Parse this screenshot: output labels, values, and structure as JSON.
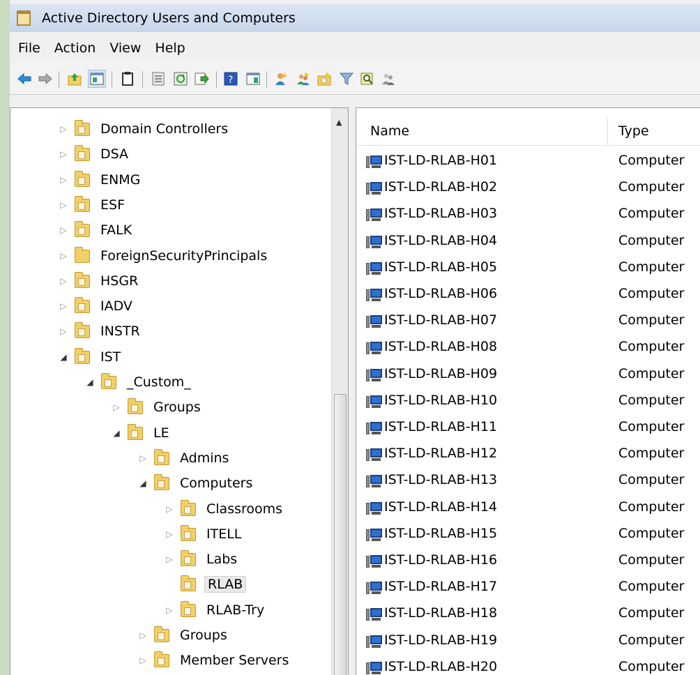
{
  "window": {
    "title": "Active Directory Users and Computers"
  },
  "menu": [
    "File",
    "Action",
    "View",
    "Help"
  ],
  "toolbar_icons": [
    "back-arrow-icon",
    "forward-arrow-icon",
    "up-folder-icon",
    "show-hide-console-tree-icon",
    "clipboard-icon",
    "properties-icon",
    "refresh-icon",
    "export-list-icon",
    "help-icon",
    "show-action-pane-icon",
    "new-user-icon",
    "new-group-icon",
    "new-ou-icon",
    "filter-icon",
    "find-icon",
    "add-to-group-icon"
  ],
  "tree": [
    {
      "label": "Domain Controllers",
      "level": 0,
      "state": "collapsed"
    },
    {
      "label": "DSA",
      "level": 0,
      "state": "collapsed"
    },
    {
      "label": "ENMG",
      "level": 0,
      "state": "collapsed"
    },
    {
      "label": "ESF",
      "level": 0,
      "state": "collapsed"
    },
    {
      "label": "FALK",
      "level": 0,
      "state": "collapsed"
    },
    {
      "label": "ForeignSecurityPrincipals",
      "level": 0,
      "state": "collapsed",
      "plain": true
    },
    {
      "label": "HSGR",
      "level": 0,
      "state": "collapsed"
    },
    {
      "label": "IADV",
      "level": 0,
      "state": "collapsed"
    },
    {
      "label": "INSTR",
      "level": 0,
      "state": "collapsed"
    },
    {
      "label": "IST",
      "level": 0,
      "state": "expanded"
    },
    {
      "label": "_Custom_",
      "level": 1,
      "state": "expanded"
    },
    {
      "label": "Groups",
      "level": 2,
      "state": "collapsed"
    },
    {
      "label": "LE",
      "level": 2,
      "state": "expanded"
    },
    {
      "label": "Admins",
      "level": 3,
      "state": "collapsed"
    },
    {
      "label": "Computers",
      "level": 3,
      "state": "expanded"
    },
    {
      "label": "Classrooms",
      "level": 4,
      "state": "collapsed"
    },
    {
      "label": "ITELL",
      "level": 4,
      "state": "collapsed"
    },
    {
      "label": "Labs",
      "level": 4,
      "state": "collapsed"
    },
    {
      "label": "RLAB",
      "level": 4,
      "state": "leaf",
      "selected": true
    },
    {
      "label": "RLAB-Try",
      "level": 4,
      "state": "collapsed"
    },
    {
      "label": "Groups",
      "level": 3,
      "state": "collapsed"
    },
    {
      "label": "Member Servers",
      "level": 3,
      "state": "collapsed"
    }
  ],
  "list": {
    "columns": [
      "Name",
      "Type"
    ],
    "rows": [
      {
        "name": "IST-LD-RLAB-H01",
        "type": "Computer"
      },
      {
        "name": "IST-LD-RLAB-H02",
        "type": "Computer"
      },
      {
        "name": "IST-LD-RLAB-H03",
        "type": "Computer"
      },
      {
        "name": "IST-LD-RLAB-H04",
        "type": "Computer"
      },
      {
        "name": "IST-LD-RLAB-H05",
        "type": "Computer"
      },
      {
        "name": "IST-LD-RLAB-H06",
        "type": "Computer"
      },
      {
        "name": "IST-LD-RLAB-H07",
        "type": "Computer"
      },
      {
        "name": "IST-LD-RLAB-H08",
        "type": "Computer"
      },
      {
        "name": "IST-LD-RLAB-H09",
        "type": "Computer"
      },
      {
        "name": "IST-LD-RLAB-H10",
        "type": "Computer"
      },
      {
        "name": "IST-LD-RLAB-H11",
        "type": "Computer"
      },
      {
        "name": "IST-LD-RLAB-H12",
        "type": "Computer"
      },
      {
        "name": "IST-LD-RLAB-H13",
        "type": "Computer"
      },
      {
        "name": "IST-LD-RLAB-H14",
        "type": "Computer"
      },
      {
        "name": "IST-LD-RLAB-H15",
        "type": "Computer"
      },
      {
        "name": "IST-LD-RLAB-H16",
        "type": "Computer"
      },
      {
        "name": "IST-LD-RLAB-H17",
        "type": "Computer"
      },
      {
        "name": "IST-LD-RLAB-H18",
        "type": "Computer"
      },
      {
        "name": "IST-LD-RLAB-H19",
        "type": "Computer"
      },
      {
        "name": "IST-LD-RLAB-H20",
        "type": "Computer"
      }
    ]
  }
}
